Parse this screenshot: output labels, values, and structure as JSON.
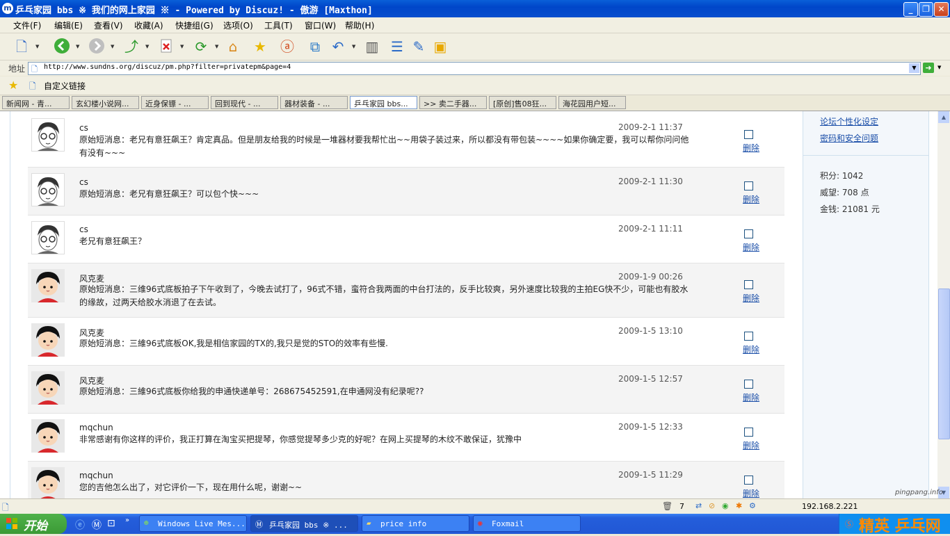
{
  "window": {
    "title": "乒乓家园 bbs ※ 我们的网上家园 ※ - Powered by Discuz! - 傲游 [Maxthon]",
    "app_icon": "m"
  },
  "menu": [
    "文件(F)",
    "编辑(E)",
    "查看(V)",
    "收藏(A)",
    "快捷组(G)",
    "选项(O)",
    "工具(T)",
    "窗口(W)",
    "帮助(H)"
  ],
  "address": {
    "label": "地址",
    "url": "http://www.sundns.org/discuz/pm.php?filter=privatepm&page=4"
  },
  "links_bar": {
    "label": "自定义链接"
  },
  "tabs": [
    {
      "label": "新闻网 - 青..."
    },
    {
      "label": "玄幻楼小说网..."
    },
    {
      "label": "近身保镖 - ..."
    },
    {
      "label": "回到现代 - ..."
    },
    {
      "label": "器材装备 - ..."
    },
    {
      "label": "乒乓家园 bbs...",
      "active": true
    },
    {
      "label": ">> 卖二手器..."
    },
    {
      "label": "[原创]售08狂..."
    },
    {
      "label": "海花园用户短..."
    }
  ],
  "messages": [
    {
      "user": "cs",
      "avatar": "cs",
      "time": "2009-2-1 11:37",
      "text": "原始短消息：老兄有意狂飙王？肯定真品。但是朋友给我的时候是一堆器材要我帮忙出~~用袋子装过来，所以都没有带包装~~~~如果你确定要，我可以帮你问问他有没有~~~",
      "delete": "删除"
    },
    {
      "user": "cs",
      "avatar": "cs",
      "time": "2009-2-1 11:30",
      "text": "原始短消息：老兄有意狂飙王？可以包个快~~~",
      "delete": "删除"
    },
    {
      "user": "cs",
      "avatar": "cs",
      "time": "2009-2-1 11:11",
      "text": "老兄有意狂飙王？",
      "delete": "删除"
    },
    {
      "user": "风克麦",
      "avatar": "kid",
      "time": "2009-1-9 00:26",
      "text": "原始短消息：三维96式底板拍子下午收到了，今晚去试打了，96式不错，蛮符合我两面的中台打法的，反手比较爽，另外速度比较我的主拍EG快不少，可能也有胶水的缘故，过两天给胶水消退了在去试。",
      "delete": "删除"
    },
    {
      "user": "风克麦",
      "avatar": "kid",
      "time": "2009-1-5 13:10",
      "text": "原始短消息：三維96式底板OK,我是相信家园的TX的,我只是觉的STO的效率有些慢.",
      "delete": "删除"
    },
    {
      "user": "风克麦",
      "avatar": "kid",
      "time": "2009-1-5 12:57",
      "text": "原始短消息：三維96式底板你给我的申通快递单号：268675452591,在申通网没有纪录呢??",
      "delete": "删除"
    },
    {
      "user": "mqchun",
      "avatar": "kid",
      "time": "2009-1-5 12:33",
      "text": "非常感谢有你这样的评价，我正打算在淘宝买把提琴，你感觉提琴多少克的好呢？在网上买提琴的木纹不敢保证，犹豫中",
      "delete": "删除"
    },
    {
      "user": "mqchun",
      "avatar": "kid",
      "time": "2009-1-5 11:29",
      "text": "您的吉他怎么出了，对它评价一下，现在用什么呢，谢谢~~",
      "delete": "删除"
    }
  ],
  "sidebar": {
    "links": [
      "论坛个性化设定",
      "密码和安全问题"
    ],
    "stats": [
      "积分: 1042",
      "威望: 708 点",
      "金钱: 21081 元"
    ]
  },
  "status": {
    "count": "7",
    "ip": "192.168.2.221",
    "watermark": "pingpang.info",
    "watermark_brand": "精英 乒乓网"
  },
  "taskbar": {
    "start": "开始",
    "tasks": [
      {
        "label": "Windows Live Mes...",
        "icon": "live-messenger-icon"
      },
      {
        "label": "乒乓家园 bbs ※ ...",
        "icon": "maxthon-icon",
        "active": true
      },
      {
        "label": "price info",
        "icon": "folder-icon"
      },
      {
        "label": "Foxmail",
        "icon": "foxmail-icon"
      }
    ]
  },
  "colors": {
    "link": "#1a4ea8",
    "titlebar": "#0A4FCE",
    "taskbar": "#245EDB",
    "start": "#3B9A36"
  }
}
